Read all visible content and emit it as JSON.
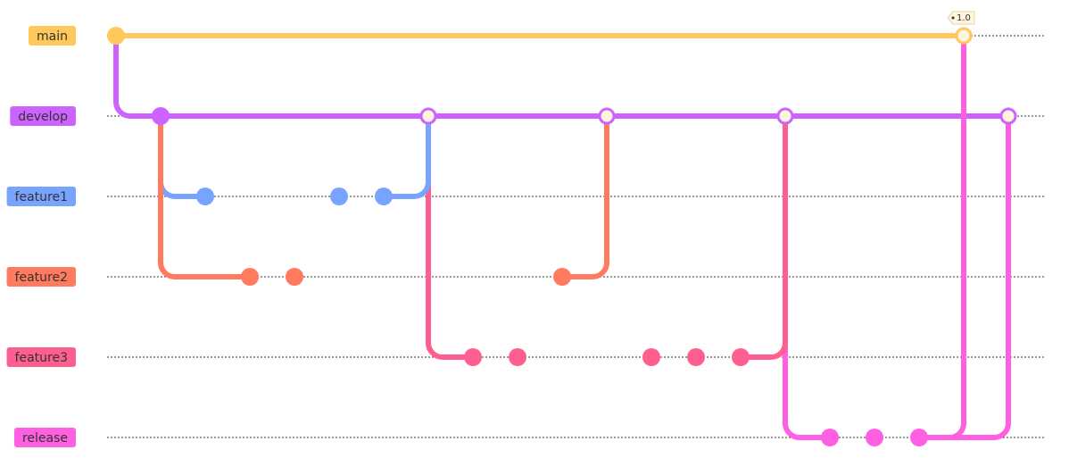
{
  "diagram": {
    "type": "gitGraph",
    "branches": [
      {
        "name": "main",
        "color": "#ffc85a"
      },
      {
        "name": "develop",
        "color": "#cc63ff"
      },
      {
        "name": "feature1",
        "color": "#78a4ff"
      },
      {
        "name": "feature2",
        "color": "#ff7a5e"
      },
      {
        "name": "feature3",
        "color": "#ff5f8f"
      },
      {
        "name": "release",
        "color": "#ff5fe0"
      }
    ],
    "commits": [
      {
        "id": "c0",
        "branch": "main",
        "seq": 0,
        "type": "normal"
      },
      {
        "id": "c1",
        "branch": "develop",
        "seq": 1,
        "type": "normal"
      },
      {
        "id": "c2",
        "branch": "feature1",
        "seq": 2,
        "type": "normal"
      },
      {
        "id": "c3",
        "branch": "feature2",
        "seq": 3,
        "type": "normal"
      },
      {
        "id": "c4",
        "branch": "feature2",
        "seq": 4,
        "type": "normal"
      },
      {
        "id": "c5",
        "branch": "feature1",
        "seq": 5,
        "type": "normal"
      },
      {
        "id": "c6",
        "branch": "feature1",
        "seq": 6,
        "type": "normal"
      },
      {
        "id": "c7",
        "branch": "develop",
        "seq": 7,
        "type": "merge",
        "parents": [
          "c1",
          "c6"
        ]
      },
      {
        "id": "c8",
        "branch": "feature3",
        "seq": 8,
        "type": "normal"
      },
      {
        "id": "c9",
        "branch": "feature3",
        "seq": 9,
        "type": "normal"
      },
      {
        "id": "c10",
        "branch": "feature2",
        "seq": 10,
        "type": "normal"
      },
      {
        "id": "c11",
        "branch": "develop",
        "seq": 11,
        "type": "merge",
        "parents": [
          "c7",
          "c10"
        ]
      },
      {
        "id": "c12",
        "branch": "feature3",
        "seq": 12,
        "type": "normal"
      },
      {
        "id": "c13",
        "branch": "feature3",
        "seq": 13,
        "type": "normal"
      },
      {
        "id": "c14",
        "branch": "feature3",
        "seq": 14,
        "type": "normal"
      },
      {
        "id": "c15",
        "branch": "develop",
        "seq": 15,
        "type": "merge",
        "parents": [
          "c11",
          "c14"
        ]
      },
      {
        "id": "c16",
        "branch": "release",
        "seq": 16,
        "type": "normal"
      },
      {
        "id": "c17",
        "branch": "release",
        "seq": 17,
        "type": "normal"
      },
      {
        "id": "c18",
        "branch": "release",
        "seq": 18,
        "type": "normal"
      },
      {
        "id": "c19",
        "branch": "main",
        "seq": 19,
        "type": "merge",
        "parents": [
          "c0",
          "c18"
        ],
        "tag": "1.0"
      },
      {
        "id": "c20",
        "branch": "develop",
        "seq": 20,
        "type": "merge",
        "parents": [
          "c15",
          "c18"
        ]
      }
    ],
    "branch_points": [
      {
        "from": "c0",
        "to_branch": "develop"
      },
      {
        "from": "c1",
        "to_branch": "feature1"
      },
      {
        "from": "c1",
        "to_branch": "feature2"
      },
      {
        "from": "c7",
        "to_branch": "feature3"
      },
      {
        "from": "c15",
        "to_branch": "release"
      }
    ],
    "merge_fill": "#fff4dd"
  }
}
